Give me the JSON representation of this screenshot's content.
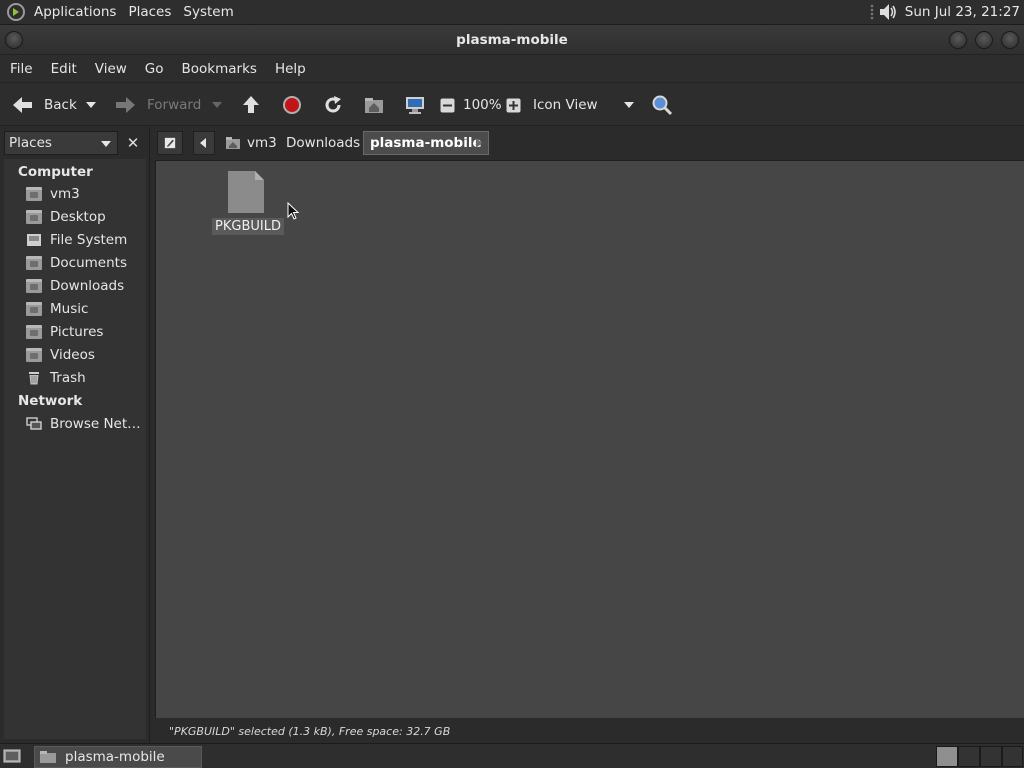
{
  "top_panel": {
    "menus": [
      "Applications",
      "Places",
      "System"
    ],
    "clock": "Sun Jul 23, 21:27"
  },
  "window": {
    "title": "plasma-mobile"
  },
  "menubar": [
    "File",
    "Edit",
    "View",
    "Go",
    "Bookmarks",
    "Help"
  ],
  "toolbar": {
    "back_label": "Back",
    "forward_label": "Forward",
    "zoom_level": "100%",
    "view_mode": "Icon View"
  },
  "sidebar": {
    "selector": "Places",
    "groups": [
      {
        "header": "Computer",
        "items": [
          "vm3",
          "Desktop",
          "File System",
          "Documents",
          "Downloads",
          "Music",
          "Pictures",
          "Videos",
          "Trash"
        ]
      },
      {
        "header": "Network",
        "items": [
          "Browse Net…"
        ]
      }
    ]
  },
  "breadcrumbs": [
    "vm3",
    "Downloads",
    "plasma-mobile"
  ],
  "files": [
    {
      "name": "PKGBUILD"
    }
  ],
  "status": "\"PKGBUILD\" selected (1.3 kB), Free space: 32.7 GB",
  "taskbar": {
    "window_button": "plasma-mobile"
  }
}
